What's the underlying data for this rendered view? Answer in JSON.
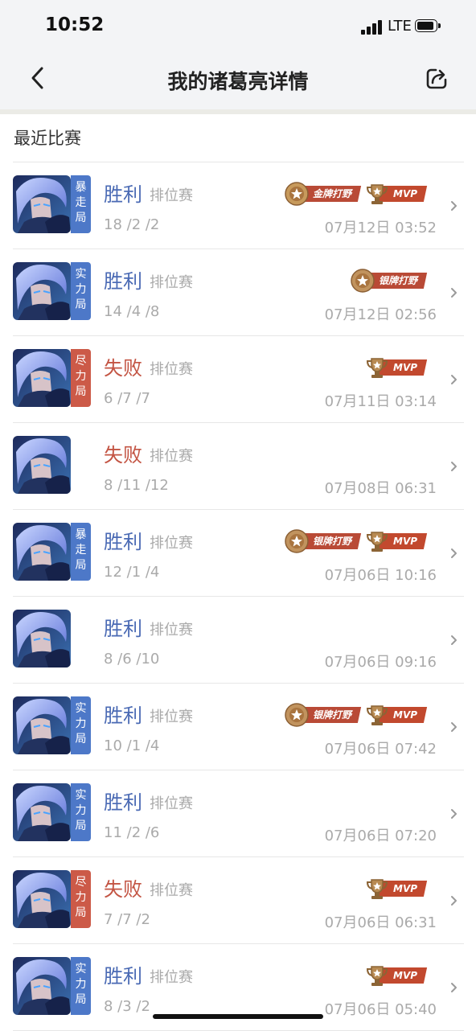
{
  "status_bar": {
    "time": "10:52",
    "network": "LTE"
  },
  "nav": {
    "title": "我的诸葛亮详情"
  },
  "section_title": "最近比赛",
  "matches": [
    {
      "result": "胜利",
      "outcome": "win",
      "mode": "排位赛",
      "kda": "18 /2 /2",
      "time": "07月12日 03:52",
      "tag": "暴走局",
      "tag_color": "blue",
      "badges": [
        {
          "type": "gold",
          "label": "金牌打野"
        },
        {
          "type": "mvp",
          "label": "MVP"
        }
      ]
    },
    {
      "result": "胜利",
      "outcome": "win",
      "mode": "排位赛",
      "kda": "14 /4 /8",
      "time": "07月12日 02:56",
      "tag": "实力局",
      "tag_color": "blue",
      "badges": [
        {
          "type": "silver",
          "label": "银牌打野"
        }
      ]
    },
    {
      "result": "失败",
      "outcome": "lose",
      "mode": "排位赛",
      "kda": "6 /7 /7",
      "time": "07月11日 03:14",
      "tag": "尽力局",
      "tag_color": "red",
      "badges": [
        {
          "type": "mvp",
          "label": "MVP"
        }
      ]
    },
    {
      "result": "失败",
      "outcome": "lose",
      "mode": "排位赛",
      "kda": "8 /11 /12",
      "time": "07月08日 06:31",
      "tag": "",
      "tag_color": "",
      "badges": []
    },
    {
      "result": "胜利",
      "outcome": "win",
      "mode": "排位赛",
      "kda": "12 /1 /4",
      "time": "07月06日 10:16",
      "tag": "暴走局",
      "tag_color": "blue",
      "badges": [
        {
          "type": "silver",
          "label": "银牌打野"
        },
        {
          "type": "mvp",
          "label": "MVP"
        }
      ]
    },
    {
      "result": "胜利",
      "outcome": "win",
      "mode": "排位赛",
      "kda": "8 /6 /10",
      "time": "07月06日 09:16",
      "tag": "",
      "tag_color": "",
      "badges": []
    },
    {
      "result": "胜利",
      "outcome": "win",
      "mode": "排位赛",
      "kda": "10 /1 /4",
      "time": "07月06日 07:42",
      "tag": "实力局",
      "tag_color": "blue",
      "badges": [
        {
          "type": "silver",
          "label": "银牌打野"
        },
        {
          "type": "mvp",
          "label": "MVP"
        }
      ]
    },
    {
      "result": "胜利",
      "outcome": "win",
      "mode": "排位赛",
      "kda": "11 /2 /6",
      "time": "07月06日 07:20",
      "tag": "实力局",
      "tag_color": "blue",
      "badges": []
    },
    {
      "result": "失败",
      "outcome": "lose",
      "mode": "排位赛",
      "kda": "7 /7 /2",
      "time": "07月06日 06:31",
      "tag": "尽力局",
      "tag_color": "red",
      "badges": [
        {
          "type": "mvp",
          "label": "MVP"
        }
      ]
    },
    {
      "result": "胜利",
      "outcome": "win",
      "mode": "排位赛",
      "kda": "8 /3 /2",
      "time": "07月06日 05:40",
      "tag": "实力局",
      "tag_color": "blue",
      "badges": [
        {
          "type": "mvp",
          "label": "MVP"
        }
      ]
    }
  ],
  "icons": {
    "back": "chevron-left-icon",
    "share": "share-icon",
    "row_arrow": "chevron-right-icon"
  },
  "colors": {
    "win": "#4a6ab4",
    "lose": "#c35443",
    "tag_blue": "#4d78c8",
    "tag_red": "#cc5a48",
    "badge_ribbon": "#b94a36"
  }
}
